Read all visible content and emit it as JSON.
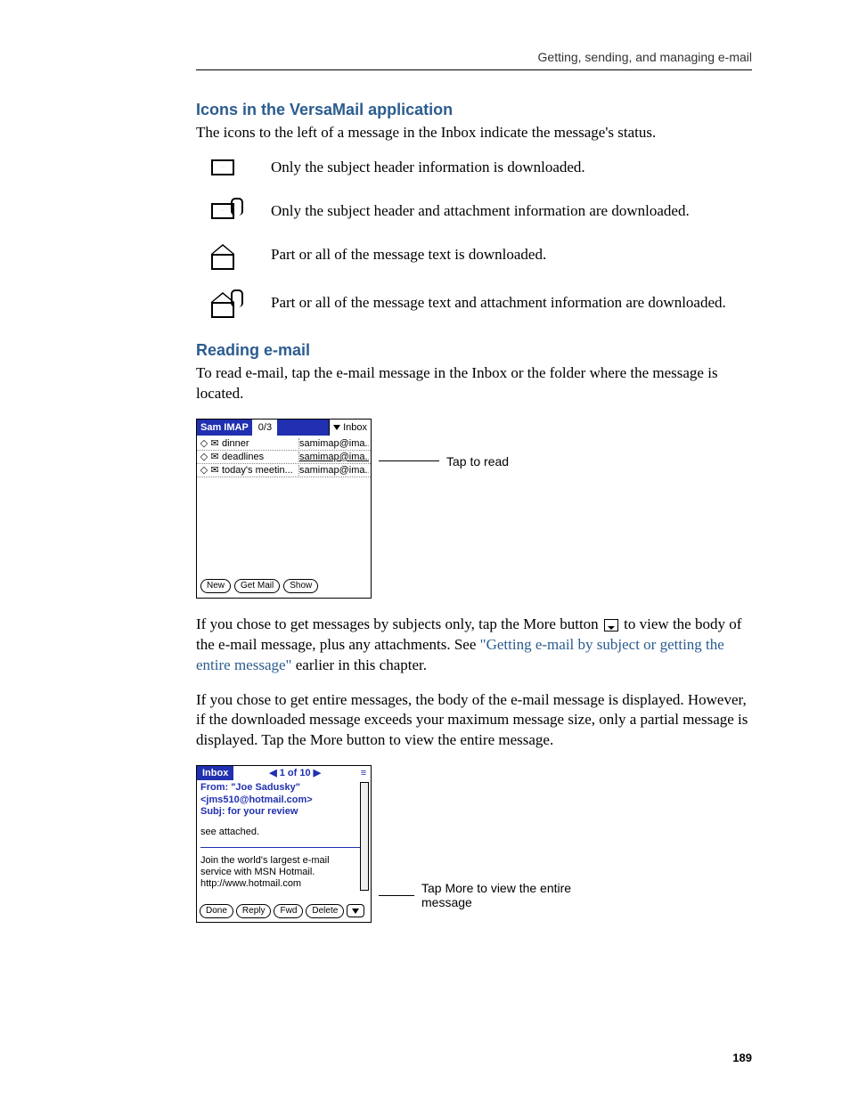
{
  "running_head": "Getting, sending, and managing e-mail",
  "page_number": "189",
  "section1": {
    "heading": "Icons in the VersaMail application",
    "intro": "The icons to the left of a message in the Inbox indicate the message's status.",
    "icons": [
      {
        "desc": "Only the subject header information is downloaded."
      },
      {
        "desc": "Only the subject header and attachment information are downloaded."
      },
      {
        "desc": "Part or all of the message text is downloaded."
      },
      {
        "desc": "Part or all of the message text and attachment information are downloaded."
      }
    ]
  },
  "section2": {
    "heading": "Reading e-mail",
    "intro": "To read e-mail, tap the e-mail message in the Inbox or the folder where the message is located."
  },
  "palm1": {
    "account": "Sam IMAP",
    "count": "0/3",
    "folder": "Inbox",
    "rows": [
      {
        "subject": "dinner",
        "sender": "samimap@ima...",
        "hl": false
      },
      {
        "subject": "deadlines",
        "sender": "samimap@ima...",
        "hl": true
      },
      {
        "subject": "today's meetin...",
        "sender": "samimap@ima...",
        "hl": false
      }
    ],
    "buttons": {
      "new": "New",
      "get": "Get Mail",
      "show": "Show"
    },
    "callout": "Tap to read"
  },
  "para_more_before": "If you chose to get messages by subjects only, tap the More button ",
  "para_more_after": " to view the body of the e-mail message, plus any attachments. See ",
  "para_more_link": "\"Getting e-mail by subject or getting the entire message\"",
  "para_more_tail": " earlier in this chapter.",
  "para_entire": "If you chose to get entire messages, the body of the e-mail message is displayed. However, if the downloaded message exceeds your maximum message size, only a partial message is displayed. Tap the More button to view the entire message.",
  "palm2": {
    "label": "Inbox",
    "nav": "◀  1 of 10  ▶",
    "from": "From: \"Joe Sadusky\"",
    "addr": "<jms510@hotmail.com>",
    "subj": "Subj: for your review",
    "body1": "see attached.",
    "sig1": "Join the world's largest e-mail",
    "sig2": "service with MSN Hotmail.",
    "sig3": "http://www.hotmail.com",
    "buttons": {
      "done": "Done",
      "reply": "Reply",
      "fwd": "Fwd",
      "delete": "Delete"
    },
    "callout": "Tap More to view the entire message"
  }
}
